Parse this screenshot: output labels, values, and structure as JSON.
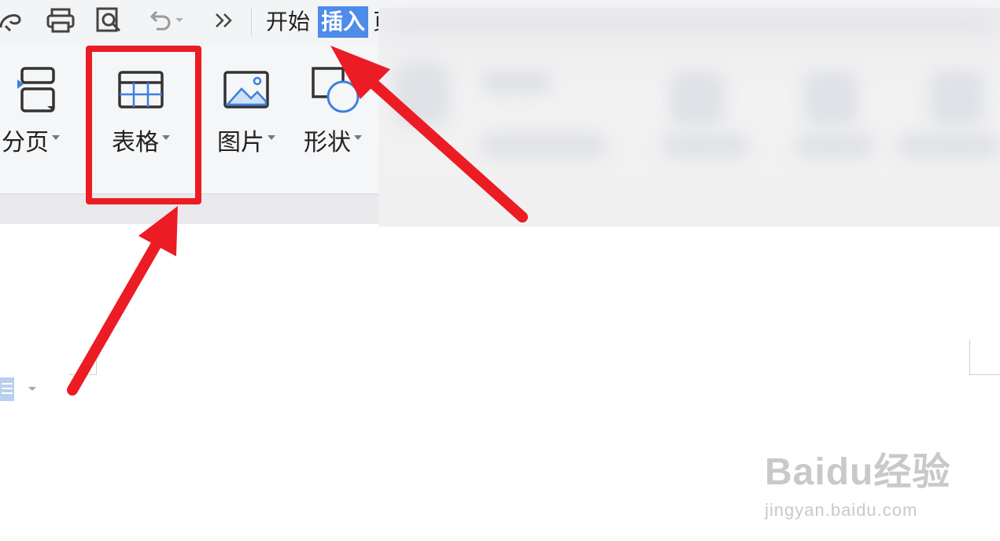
{
  "tabs": {
    "home": "开始",
    "insert": "插入",
    "partial_next": "页"
  },
  "ribbon": {
    "page_break": "分页",
    "table": "表格",
    "picture": "图片",
    "shape": "形状"
  },
  "watermark": {
    "brand": "Baidu经验",
    "url": "jingyan.baidu.com"
  },
  "colors": {
    "active_tab": "#4f8be8",
    "annotation_red": "#ec1c24",
    "icon_blue": "#3d7fe0"
  }
}
